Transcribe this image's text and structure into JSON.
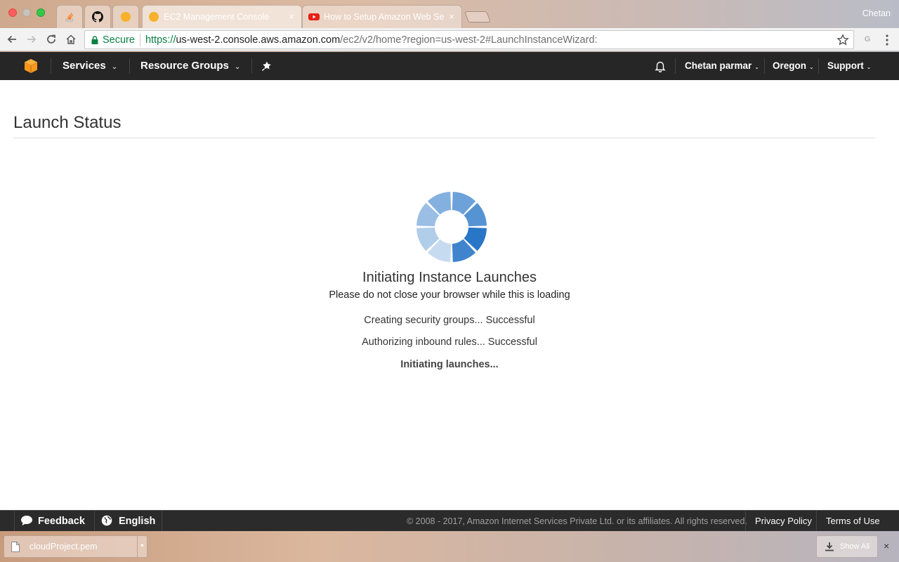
{
  "browser": {
    "profile_name": "Chetan",
    "tabs": [
      {
        "title": "",
        "icon": "stackoverflow-icon",
        "pinned": true
      },
      {
        "title": "",
        "icon": "github-icon",
        "pinned": true
      },
      {
        "title": "",
        "icon": "aws-favicon-icon",
        "pinned": true
      },
      {
        "title": "EC2 Management Console",
        "icon": "aws-favicon-icon",
        "active": true
      },
      {
        "title": "How to Setup Amazon Web Se",
        "icon": "youtube-icon"
      }
    ],
    "close_glyph": "×",
    "omnibox": {
      "secure_label": "Secure",
      "url_protocol": "https://",
      "url_host": "us-west-2.console.aws.amazon.com",
      "url_path": "/ec2/v2/home?region=us-west-2#LaunchInstanceWizard:"
    },
    "extension_letter": "G"
  },
  "aws_nav": {
    "services_label": "Services",
    "resource_groups_label": "Resource Groups",
    "user_label": "Chetan parmar",
    "region_label": "Oregon",
    "support_label": "Support",
    "caret": "⌄"
  },
  "main": {
    "page_title": "Launch Status",
    "spinner_color": "#1e6fc4",
    "status_heading": "Initiating Instance Launches",
    "status_sub": "Please do not close your browser while this is loading",
    "steps": [
      "Creating security groups... Successful",
      "Authorizing inbound rules... Successful",
      "Initiating launches..."
    ]
  },
  "footer": {
    "feedback_label": "Feedback",
    "language_label": "English",
    "copyright": "© 2008 - 2017, Amazon Internet Services Private Ltd. or its affiliates. All rights reserved.",
    "privacy_label": "Privacy Policy",
    "terms_label": "Terms of Use"
  },
  "download_shelf": {
    "file_name": "cloudProject.pem",
    "show_all_label": "Show All",
    "close_glyph": "×"
  }
}
